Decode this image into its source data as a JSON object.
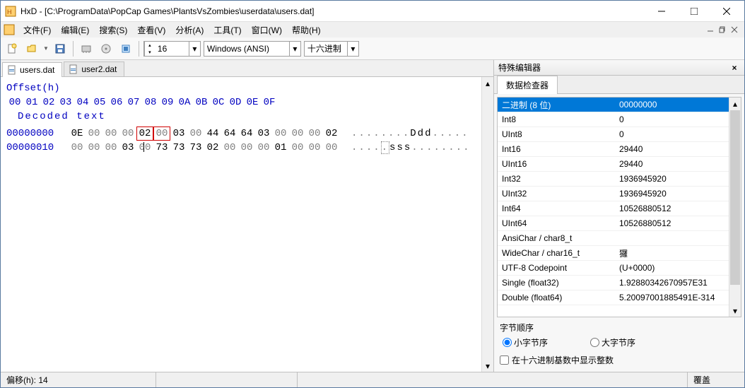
{
  "window": {
    "title": "HxD - [C:\\ProgramData\\PopCap Games\\PlantsVsZombies\\userdata\\users.dat]"
  },
  "menu": {
    "file": "文件(F)",
    "edit": "编辑(E)",
    "search": "搜索(S)",
    "view": "查看(V)",
    "analysis": "分析(A)",
    "tools": "工具(T)",
    "window": "窗口(W)",
    "help": "帮助(H)"
  },
  "toolbar": {
    "bytes_per_row": "16",
    "encoding": "Windows (ANSI)",
    "radix": "十六进制"
  },
  "tabs": [
    {
      "label": "users.dat",
      "active": true
    },
    {
      "label": "user2.dat",
      "active": false
    }
  ],
  "hex": {
    "offset_header": "Offset(h)",
    "columns": [
      "00",
      "01",
      "02",
      "03",
      "04",
      "05",
      "06",
      "07",
      "08",
      "09",
      "0A",
      "0B",
      "0C",
      "0D",
      "0E",
      "0F"
    ],
    "decoded_header": "Decoded text",
    "rows": [
      {
        "offset": "00000000",
        "bytes": [
          "0E",
          "00",
          "00",
          "00",
          "02",
          "00",
          "03",
          "00",
          "44",
          "64",
          "64",
          "03",
          "00",
          "00",
          "00",
          "02"
        ],
        "selected": [
          4,
          5
        ],
        "decoded": [
          ".",
          ".",
          ".",
          ".",
          ".",
          ".",
          ".",
          ".",
          "D",
          "d",
          "d",
          ".",
          ".",
          ".",
          ".",
          "."
        ]
      },
      {
        "offset": "00000010",
        "bytes": [
          "00",
          "00",
          "00",
          "03",
          "00",
          "73",
          "73",
          "73",
          "02",
          "00",
          "00",
          "00",
          "01",
          "00",
          "00",
          "00"
        ],
        "caret": 4,
        "decoded_sel": 4,
        "decoded": [
          ".",
          ".",
          ".",
          ".",
          ".",
          "s",
          "s",
          "s",
          ".",
          ".",
          ".",
          ".",
          ".",
          ".",
          ".",
          "."
        ]
      }
    ]
  },
  "side": {
    "header": "特殊编辑器",
    "tab": "数据检查器",
    "rows": [
      {
        "label": "二进制 (8 位)",
        "value": "00000000",
        "selected": true
      },
      {
        "label": "Int8",
        "value": "0"
      },
      {
        "label": "UInt8",
        "value": "0"
      },
      {
        "label": "Int16",
        "value": "29440"
      },
      {
        "label": "UInt16",
        "value": "29440"
      },
      {
        "label": "Int32",
        "value": "1936945920"
      },
      {
        "label": "UInt32",
        "value": "1936945920"
      },
      {
        "label": "Int64",
        "value": "10526880512"
      },
      {
        "label": "UInt64",
        "value": "10526880512"
      },
      {
        "label": "AnsiChar / char8_t",
        "value": ""
      },
      {
        "label": "WideChar / char16_t",
        "value": "玀"
      },
      {
        "label": "UTF-8 Codepoint",
        "value": "   (U+0000)"
      },
      {
        "label": "Single (float32)",
        "value": "1.92880342670957E31"
      },
      {
        "label": "Double (float64)",
        "value": "5.20097001885491E-314"
      }
    ],
    "byte_order_label": "字节顺序",
    "little_endian": "小字节序",
    "big_endian": "大字节序",
    "show_int_hex": "在十六进制基数中显示整数"
  },
  "status": {
    "offset": "偏移(h): 14",
    "overwrite": "覆盖"
  }
}
